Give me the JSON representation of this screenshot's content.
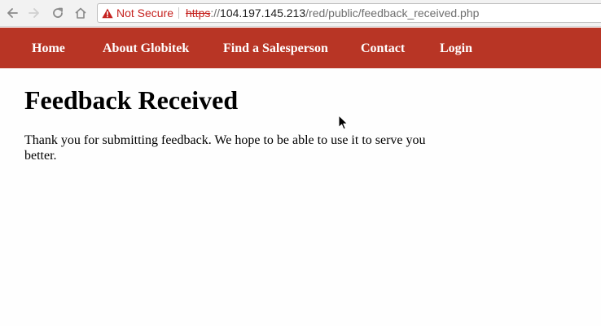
{
  "browser": {
    "security_label": "Not Secure",
    "url": {
      "scheme": "https",
      "separator": "://",
      "host": "104.197.145.213",
      "path": "/red/public/feedback_received.php"
    },
    "icons": {
      "back": "back-arrow-icon",
      "forward": "forward-arrow-icon",
      "reload": "reload-icon",
      "home": "home-icon",
      "security": "warning-triangle-icon"
    }
  },
  "nav": {
    "items": [
      {
        "label": "Home"
      },
      {
        "label": "About Globitek"
      },
      {
        "label": "Find a Salesperson"
      },
      {
        "label": "Contact"
      },
      {
        "label": "Login"
      }
    ]
  },
  "main": {
    "title": "Feedback Received",
    "message": "Thank you for submitting feedback. We hope to be able to use it to serve you better."
  },
  "colors": {
    "nav_background": "#b83525",
    "nav_text": "#ffffff",
    "security_warning": "#c5221f",
    "page_background": "#fefefe"
  }
}
